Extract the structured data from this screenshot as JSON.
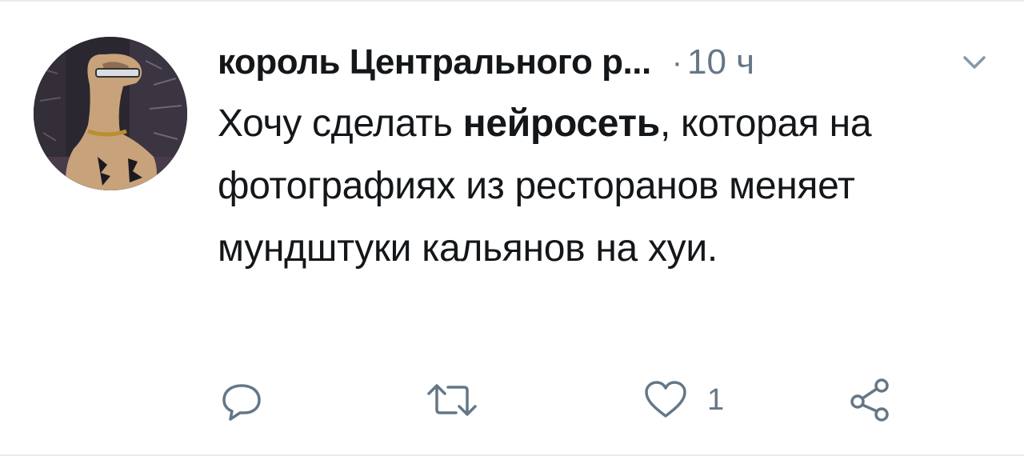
{
  "tweet": {
    "author_name": "король Центрального р...",
    "separator": "·",
    "timestamp": "10 ч",
    "text": {
      "part1": "Хочу сделать ",
      "bold": "нейросеть",
      "part2": ", которая на фотографиях из ресторанов меняет мундштуки кальянов на хуи."
    }
  },
  "actions": {
    "reply_icon": "reply-icon",
    "retweet_icon": "retweet-icon",
    "like_icon": "heart-icon",
    "like_count": "1",
    "share_icon": "share-icon"
  },
  "colors": {
    "text": "#14171a",
    "muted": "#657786",
    "divider": "#e6ecf0"
  }
}
